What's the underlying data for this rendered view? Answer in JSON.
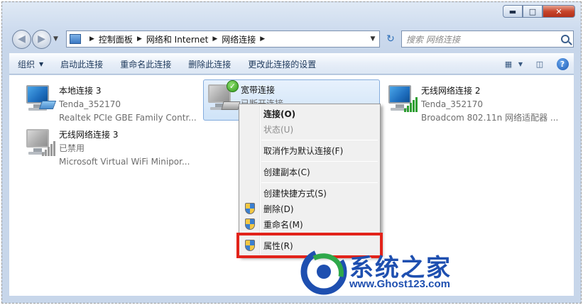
{
  "nav": {
    "breadcrumbs": [
      "控制面板",
      "网络和 Internet",
      "网络连接"
    ],
    "search_placeholder": "搜索 网络连接"
  },
  "toolbar": {
    "organize": "组织",
    "items": [
      "启动此连接",
      "重命名此连接",
      "删除此连接",
      "更改此连接的设置"
    ]
  },
  "connections": [
    {
      "name": "本地连接 3",
      "status": "Tenda_352170",
      "device": "Realtek PCIe GBE Family Contr...",
      "icon": "wired-network-icon"
    },
    {
      "name": "宽带连接",
      "status": "已断开连接",
      "device": "",
      "icon": "broadband-icon"
    },
    {
      "name": "无线网络连接 2",
      "status": "Tenda_352170",
      "device": "Broadcom 802.11n 网络适配器 ...",
      "icon": "wireless-network-icon"
    },
    {
      "name": "无线网络连接 3",
      "status": "已禁用",
      "device": "Microsoft Virtual WiFi Minipor...",
      "icon": "wireless-network-disabled-icon"
    }
  ],
  "context_menu": {
    "items": [
      {
        "label": "连接(O)"
      },
      {
        "label": "状态(U)"
      },
      {
        "label": "取消作为默认连接(F)"
      },
      {
        "label": "创建副本(C)"
      },
      {
        "label": "创建快捷方式(S)"
      },
      {
        "label": "删除(D)"
      },
      {
        "label": "重命名(M)"
      },
      {
        "label": "属性(R)"
      }
    ]
  },
  "watermark": {
    "title": "系统之家",
    "url": "www.Ghost123.com"
  },
  "colors": {
    "highlight": "#e2231a",
    "selection": "#cfe3f8",
    "watermark": "#1e4fb0"
  }
}
